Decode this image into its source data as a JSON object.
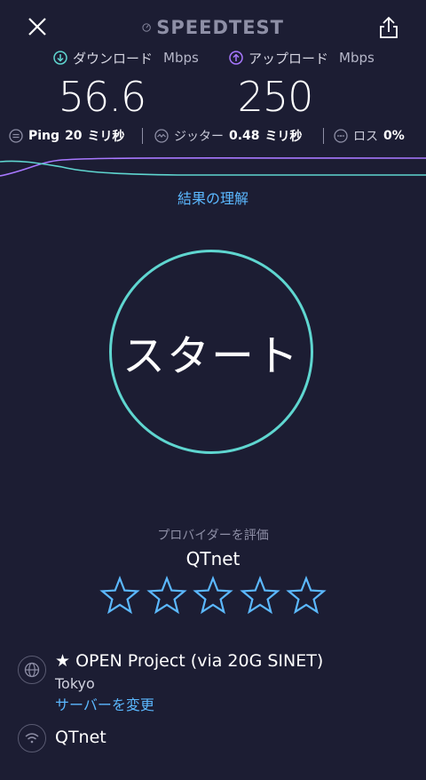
{
  "header": {
    "logo_text": "SPEEDTEST",
    "close_icon": "close-icon",
    "share_icon": "share-icon"
  },
  "download": {
    "label": "ダウンロード",
    "unit": "Mbps",
    "value": "56.6",
    "icon": "download-arrow-icon"
  },
  "upload": {
    "label": "アップロード",
    "unit": "Mbps",
    "value": "250",
    "icon": "upload-arrow-icon"
  },
  "stats": {
    "ping": {
      "label": "Ping",
      "value": "20",
      "unit": "ミリ秒"
    },
    "jitter": {
      "label": "ジッター",
      "value": "0.48",
      "unit": "ミリ秒"
    },
    "loss": {
      "label": "ロス",
      "value": "0%"
    }
  },
  "understand_link": "結果の理解",
  "start_button": "スタート",
  "rating": {
    "prompt": "プロバイダーを評価",
    "provider": "QTnet",
    "stars": 0,
    "max_stars": 5
  },
  "server": {
    "name": "★ OPEN Project (via 20G SINET)",
    "city": "Tokyo",
    "change_link": "サーバーを変更"
  },
  "isp": {
    "name": "QTnet"
  },
  "colors": {
    "background": "#1c1d33",
    "download_accent": "#5fd6d0",
    "upload_accent": "#a878ff",
    "link": "#5bb8ff",
    "star": "#5bb8ff"
  }
}
